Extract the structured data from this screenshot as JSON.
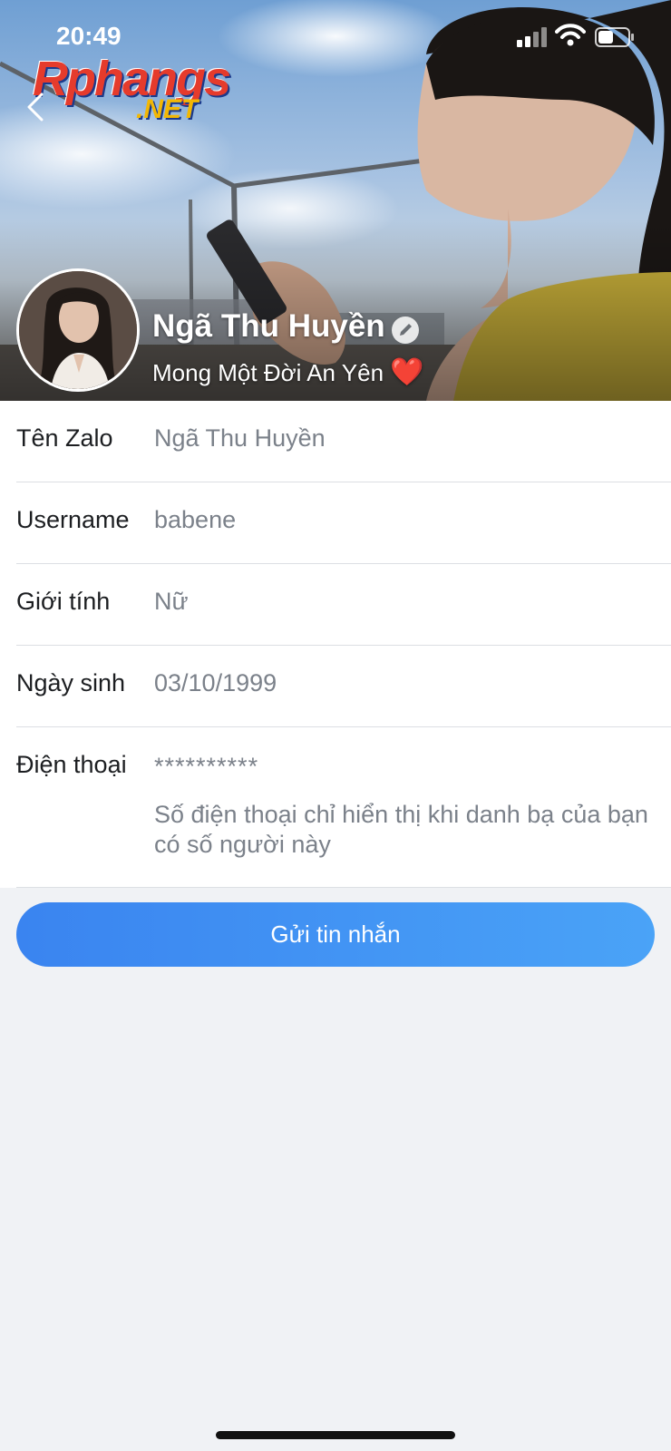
{
  "status_bar": {
    "time": "20:49"
  },
  "watermark": {
    "main": "Rphangs",
    "sub": ".NET"
  },
  "profile": {
    "name": "Ngã Thu Huyền",
    "status": "Mong Một Đời An Yên",
    "status_emoji": "❤️"
  },
  "info_rows": [
    {
      "label": "Tên Zalo",
      "value": "Ngã Thu Huyền"
    },
    {
      "label": "Username",
      "value": "babene"
    },
    {
      "label": "Giới tính",
      "value": "Nữ"
    },
    {
      "label": "Ngày sinh",
      "value": "03/10/1999"
    },
    {
      "label": "Điện thoại",
      "value": "**********",
      "note": "Số điện thoại chỉ hiển thị khi danh bạ của bạn có số người này"
    }
  ],
  "actions": {
    "send_message": "Gửi tin nhắn"
  },
  "colors": {
    "accent": "#3a84f0",
    "accent_end": "#4aa3f7",
    "background": "#f0f2f5",
    "value_text": "#7b818a"
  }
}
